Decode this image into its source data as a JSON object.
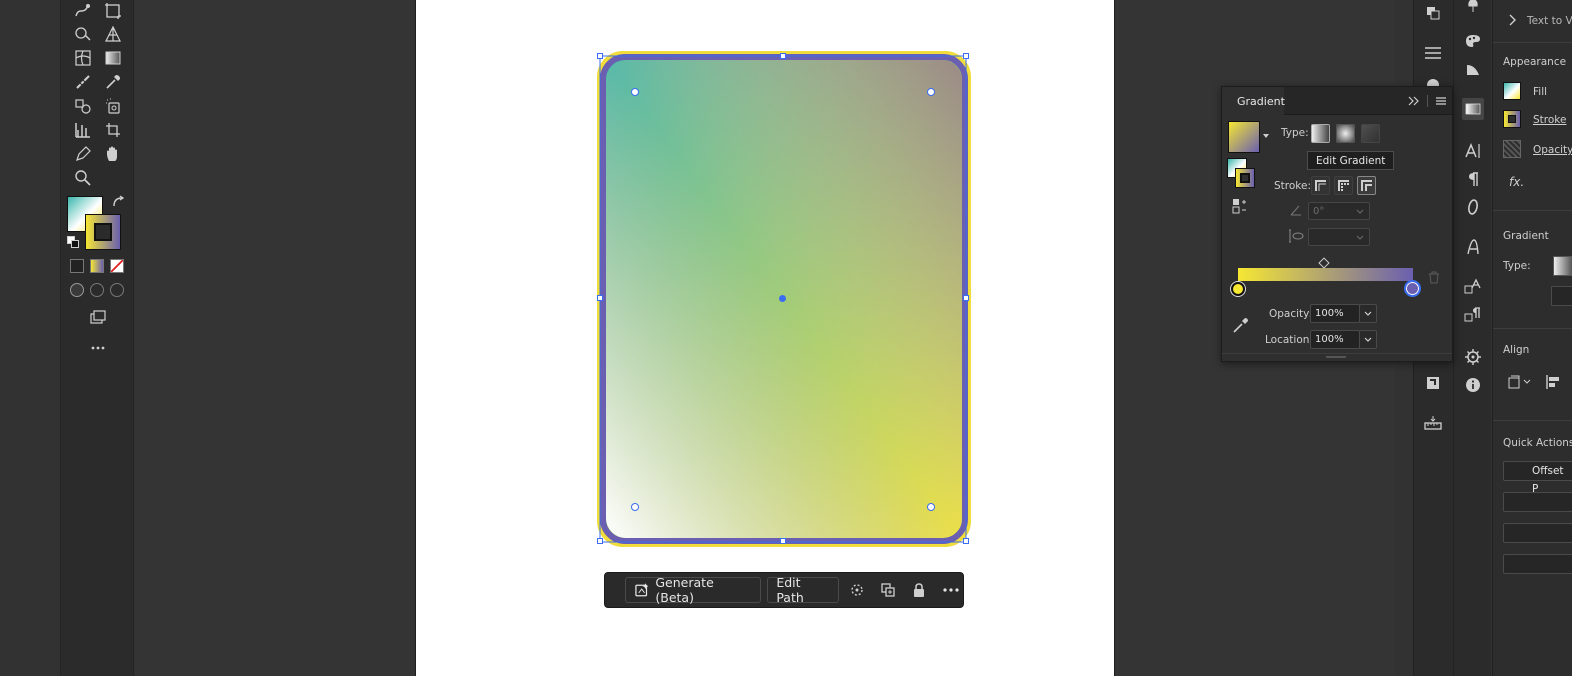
{
  "canvas": {
    "fill_gradient": {
      "colors": [
        "#3ab7ad",
        "#9b8a86",
        "#ffffff",
        "#f6e733"
      ],
      "stroke_colors": [
        "#f6e733",
        "#6a5fb0"
      ]
    }
  },
  "context_bar": {
    "generate_label": "Generate (Beta)",
    "edit_path_label": "Edit Path"
  },
  "gradient_panel": {
    "title": "Gradient",
    "type_label": "Type:",
    "tooltip": "Edit Gradient",
    "stroke_label": "Stroke:",
    "angle_value": "0°",
    "opacity_label": "Opacity:",
    "opacity_value": "100%",
    "location_label": "Location:",
    "location_value": "100%",
    "ramp_colors": [
      "#f6e733",
      "#6a5fb0"
    ]
  },
  "properties": {
    "text_to_vector": "Text to Ve",
    "appearance_title": "Appearance",
    "fill_label": "Fill",
    "stroke_label": "Stroke",
    "opacity_label": "Opacity",
    "fx_label": "fx.",
    "gradient_title": "Gradient",
    "type_label": "Type:",
    "align_title": "Align",
    "quick_actions_title": "Quick Actions",
    "offset_button": "Offset P"
  },
  "icons": {
    "toolbar": [
      "blob-brush-icon",
      "artboard-icon",
      "shape-builder-icon",
      "perspective-grid-icon",
      "mesh-icon",
      "gradient-icon",
      "eyedropper-icon",
      "measure-icon",
      "blend-icon",
      "symbol-sprayer-icon",
      "column-graph-icon",
      "slice-icon",
      "pen-icon",
      "hand-icon",
      "zoom-icon",
      "swap-icon",
      "more-tools-icon"
    ]
  }
}
